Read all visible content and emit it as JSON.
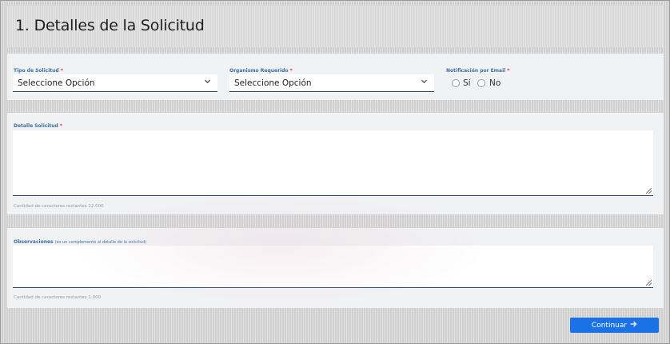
{
  "section": {
    "title": "1. Detalles de la Solicitud"
  },
  "fields": {
    "tipo_solicitud": {
      "label": "Tipo de Solicitud",
      "required_mark": "*",
      "value": "Seleccione Opción"
    },
    "organismo_requerido": {
      "label": "Organismo Requerido",
      "required_mark": "*",
      "value": "Seleccione Opción"
    },
    "notificacion_email": {
      "label": "Notificación por Email",
      "required_mark": "*",
      "options": [
        "Sí",
        "No"
      ]
    },
    "detalle_solicitud": {
      "label": "Detalle Solicitud",
      "required_mark": "*",
      "value": "",
      "counter": "Cantidad de caracteres restantes 12.000"
    },
    "observaciones": {
      "label": "Observaciones",
      "sublabel": "(es un complemento al detalle de la solicitud)",
      "value": "",
      "counter": "Cantidad de caracteres restantes 1.000"
    }
  },
  "actions": {
    "continue_label": "Continuar",
    "continue_icon": "→"
  },
  "icons": {
    "chevron": "chevron-down-icon",
    "arrow": "arrow-right-icon"
  },
  "colors": {
    "label": "#3d6fa8",
    "required": "#e0303a",
    "button": "#1a72e6"
  }
}
